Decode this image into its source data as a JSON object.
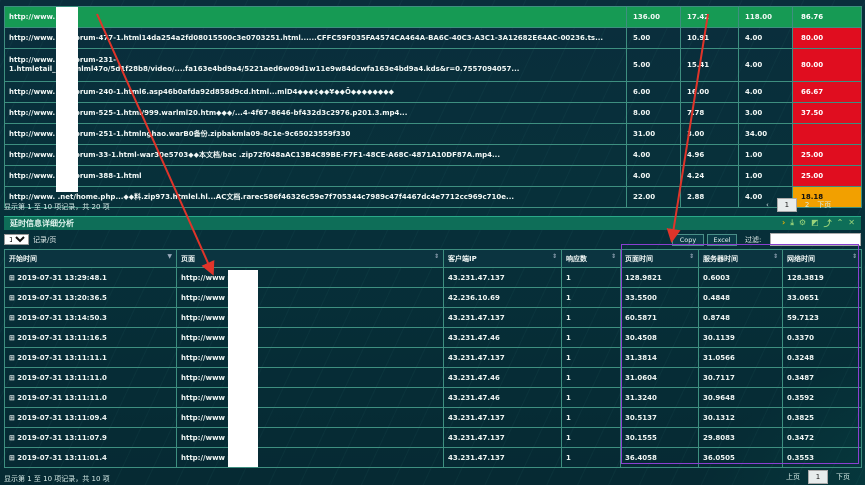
{
  "top_table": {
    "rows": [
      {
        "url": "http://www.        .cn/",
        "c1": "136.00",
        "c2": "17.42",
        "c3": "",
        "c4": "118.00",
        "rate": "86.76",
        "rate_color": "red",
        "selected": true
      },
      {
        "url": "http://www.        .cn/forum-477-1.html14da254a2fd08015500c3e0703251.html......CFFC59F035FA4574CA464A-BA6C-40C3-A3C1-3A12682E64AC-00236.ts...",
        "c1": "5.00",
        "c2": "10.91",
        "c3": "",
        "c4": "4.00",
        "rate": "80.00",
        "rate_color": "red"
      },
      {
        "url": "http://www.        .cn/forum-231-\n1.htmletail_     0.htmlml47o/5d1f28b8/video/....fa163e4bd9a4/5221aed6w09d1w11e9w84dcwfa163e4bd9a4.kds&r=0.7557094057...",
        "c1": "5.00",
        "c2": "15.41",
        "c3": "",
        "c4": "4.00",
        "rate": "80.00",
        "rate_color": "red",
        "tall": true
      },
      {
        "url": "http://www.        .cn/forum-240-1.html6.asp46b0afda92d858d9cd.html...mlD4◆◆◆¢◆◆¥◆◆Ö◆◆◆◆◆◆◆◆",
        "c1": "6.00",
        "c2": "16.00",
        "c3": "",
        "c4": "4.00",
        "rate": "66.67",
        "rate_color": "red"
      },
      {
        "url": "http://www.        .cn/forum-525-1.html/999.warlml20.htm◆◆◆/...4-4f67-8646-bf432d3c2976.p201.3.mp4...",
        "c1": "8.00",
        "c2": "7.78",
        "c3": "",
        "c4": "3.00",
        "rate": "37.50",
        "rate_color": "red"
      },
      {
        "url": "http://www.        .cn/forum-251-1.htmlnghao.warB0备份.zipbakmla09-8c1e-9c65023559f330",
        "c1": "31.00",
        "c2": "3.00",
        "c3": "33.00",
        "c4": "34.00",
        "rate": "",
        "rate_color": "red"
      },
      {
        "url": "http://www.        .cn/forum-33-1.html-war30e5703◆◆本文档/bac .zip72f048aAC13B4C89BE-F7F1-48CE-A68C-4871A10DF87A.mp4...",
        "c1": "4.00",
        "c2": "4.96",
        "c3": "",
        "c4": "1.00",
        "rate": "25.00",
        "rate_color": "red"
      },
      {
        "url": "http://www.        .cn/forum-388-1.html",
        "c1": "4.00",
        "c2": "4.24",
        "c3": "",
        "c4": "1.00",
        "rate": "25.00",
        "rate_color": "red"
      },
      {
        "url": "http://www.        .net/home.php...◆◆料.zip973.htmlel.hl...AC文档.rarec586f46326c59e7f705344c7989c47f4467dc4e7712cc969c710e...",
        "c1": "22.00",
        "c2": "2.88",
        "c3": "",
        "c4": "4.00",
        "rate": "18.18",
        "rate_color": "orange"
      }
    ],
    "info": "显示第 1 至 10 项记录，共 20 项",
    "pages": [
      "1",
      "2"
    ],
    "next": "下页"
  },
  "section": {
    "title": "延时信息详细分析"
  },
  "controls": {
    "page_size": "10",
    "page_size_label": "记录/页",
    "copy": "Copy",
    "excel": "Excel",
    "filter_label": "过滤:"
  },
  "detail_table": {
    "headers": [
      "开始时间",
      "页面",
      "客户端IP",
      "响应数",
      "页面时间",
      "服务器时间",
      "网络时间"
    ],
    "rows": [
      [
        "⊞ 2019-07-31 13:29:48.1",
        "http://www         n/",
        "43.231.47.137",
        "1",
        "128.9821",
        "0.6003",
        "128.3819"
      ],
      [
        "⊞ 2019-07-31 13:20:36.5",
        "http://www         n/",
        "42.236.10.69",
        "1",
        "33.5500",
        "0.4848",
        "33.0651"
      ],
      [
        "⊞ 2019-07-31 13:14:50.3",
        "http://www         n/",
        "43.231.47.137",
        "1",
        "60.5871",
        "0.8748",
        "59.7123"
      ],
      [
        "⊞ 2019-07-31 13:11:16.5",
        "http://www         n/",
        "43.231.47.46",
        "1",
        "30.4508",
        "30.1139",
        "0.3370"
      ],
      [
        "⊞ 2019-07-31 13:11:11.1",
        "http://www         n/",
        "43.231.47.137",
        "1",
        "31.3814",
        "31.0566",
        "0.3248"
      ],
      [
        "⊞ 2019-07-31 13:11:11.0",
        "http://www         n/",
        "43.231.47.46",
        "1",
        "31.0604",
        "30.7117",
        "0.3487"
      ],
      [
        "⊞ 2019-07-31 13:11:11.0",
        "http://www         n/",
        "43.231.47.46",
        "1",
        "31.3240",
        "30.9648",
        "0.3592"
      ],
      [
        "⊞ 2019-07-31 13:11:09.4",
        "http://www         n/",
        "43.231.47.137",
        "1",
        "30.5137",
        "30.1312",
        "0.3825"
      ],
      [
        "⊞ 2019-07-31 13:11:07.9",
        "http://www         n/",
        "43.231.47.137",
        "1",
        "30.1555",
        "29.8083",
        "0.3472"
      ],
      [
        "⊞ 2019-07-31 13:11:01.4",
        "http://www         n/",
        "43.231.47.137",
        "1",
        "36.4058",
        "36.0505",
        "0.3553"
      ]
    ],
    "info": "显示第 1 至 10 项记录，共 10 项",
    "prev": "上页",
    "page": "1",
    "next": "下页"
  },
  "colors": {
    "selected_row": "#169a54",
    "red": "#e00d1f",
    "orange": "#f2a000",
    "highlight_box": "#8a3fd1",
    "arrow": "#e0342a"
  },
  "icons": [
    "collapse-arrow-icon",
    "download-icon",
    "settings-icon",
    "chart-icon",
    "link-icon",
    "expand-icon",
    "close-icon"
  ]
}
